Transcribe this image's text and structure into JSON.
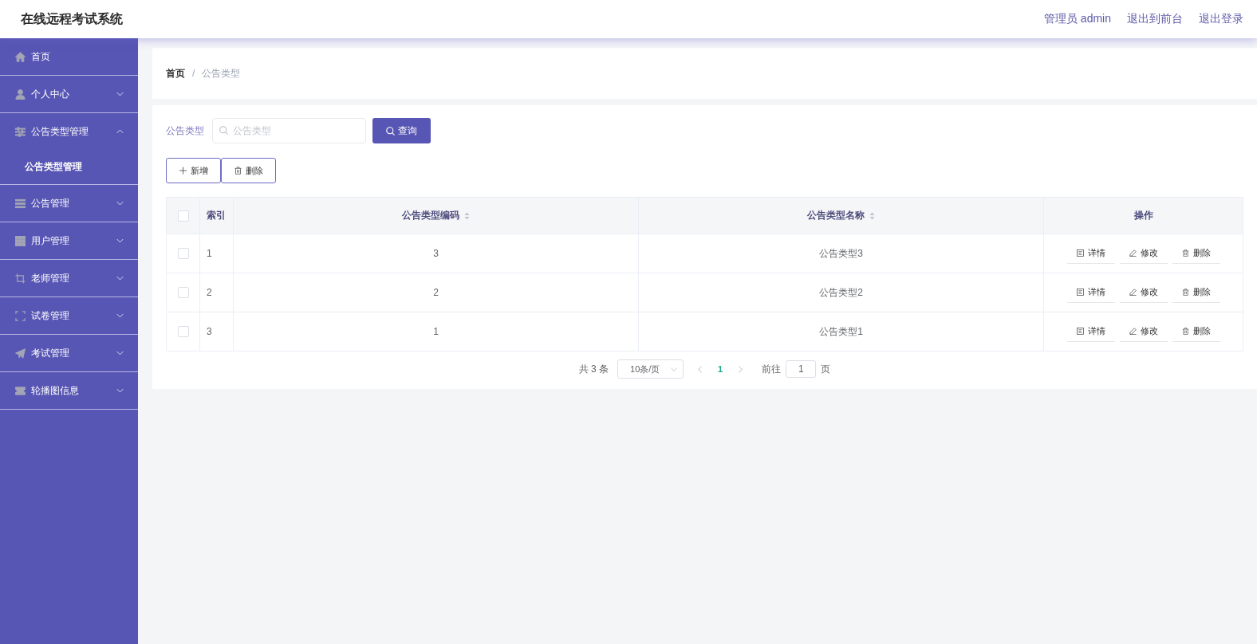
{
  "header": {
    "title": "在线远程考试系统",
    "links": [
      "管理员 admin",
      "退出到前台",
      "退出登录"
    ]
  },
  "sidebar": {
    "items": [
      {
        "label": "首页",
        "kind": "link"
      },
      {
        "label": "个人中心",
        "kind": "submenu",
        "expanded": false
      },
      {
        "label": "公告类型管理",
        "kind": "submenu",
        "expanded": true,
        "children": [
          {
            "label": "公告类型管理"
          }
        ]
      },
      {
        "label": "公告管理",
        "kind": "submenu",
        "expanded": false
      },
      {
        "label": "用户管理",
        "kind": "submenu",
        "expanded": false
      },
      {
        "label": "老师管理",
        "kind": "submenu",
        "expanded": false
      },
      {
        "label": "试卷管理",
        "kind": "submenu",
        "expanded": false
      },
      {
        "label": "考试管理",
        "kind": "submenu",
        "expanded": false
      },
      {
        "label": "轮播图信息",
        "kind": "submenu",
        "expanded": false
      }
    ]
  },
  "breadcrumb": {
    "items": [
      "首页",
      "公告类型"
    ],
    "separator": "/"
  },
  "search": {
    "label": "公告类型",
    "placeholder": "公告类型",
    "button": "查询"
  },
  "toolbar": [
    {
      "label": "新增",
      "kind": "add"
    },
    {
      "label": "删除",
      "kind": "delete"
    }
  ],
  "table": {
    "select_all": {
      "checked": false
    },
    "columns": [
      {
        "label": "索引",
        "sortable": false
      },
      {
        "label": "公告类型编码",
        "sortable": true
      },
      {
        "label": "公告类型名称",
        "sortable": true
      },
      {
        "label": "操作",
        "sortable": false
      }
    ],
    "rows": [
      {
        "checked": false,
        "cells": [
          "1",
          "3",
          "公告类型3"
        ],
        "actions": [
          {
            "label": "详情",
            "kind": "details"
          },
          {
            "label": "修改",
            "kind": "edit"
          },
          {
            "label": "删除",
            "kind": "delete"
          }
        ]
      },
      {
        "checked": false,
        "cells": [
          "2",
          "2",
          "公告类型2"
        ],
        "actions": [
          {
            "label": "详情",
            "kind": "details"
          },
          {
            "label": "修改",
            "kind": "edit"
          },
          {
            "label": "删除",
            "kind": "delete"
          }
        ]
      },
      {
        "checked": false,
        "cells": [
          "3",
          "1",
          "公告类型1"
        ],
        "actions": [
          {
            "label": "详情",
            "kind": "details"
          },
          {
            "label": "修改",
            "kind": "edit"
          },
          {
            "label": "删除",
            "kind": "delete"
          }
        ]
      }
    ]
  },
  "pagination": {
    "total": "共 3 条",
    "page_size": "10条/页",
    "pages": [
      {
        "label": "1",
        "selected": true
      }
    ],
    "goto_label": "前往",
    "goto_value": "1",
    "goto_suffix": "页"
  }
}
